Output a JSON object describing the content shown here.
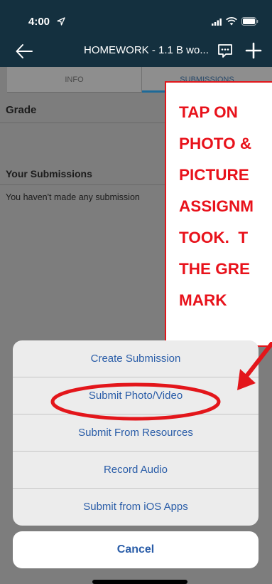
{
  "status_bar": {
    "time": "4:00"
  },
  "nav": {
    "title": "HOMEWORK - 1.1 B wo..."
  },
  "tabs": [
    {
      "label": "INFO",
      "selected": false
    },
    {
      "label": "SUBMISSIONS",
      "selected": true
    }
  ],
  "content": {
    "grade_label": "Grade",
    "submissions_label": "Your Submissions",
    "submissions_empty": "You haven't made any submission"
  },
  "annotation": {
    "lines": [
      "TAP ON",
      "PHOTO &",
      "PICTURE",
      "ASSIGNM",
      "TOOK.  T",
      "THE GRE",
      "MARK"
    ],
    "color": "#e8121b"
  },
  "action_sheet": {
    "items": [
      {
        "label": "Create Submission"
      },
      {
        "label": "Submit Photo/Video",
        "highlighted": true
      },
      {
        "label": "Submit From Resources"
      },
      {
        "label": "Record Audio"
      },
      {
        "label": "Submit from iOS Apps"
      }
    ],
    "cancel_label": "Cancel",
    "accent_color": "#2a5da8"
  }
}
